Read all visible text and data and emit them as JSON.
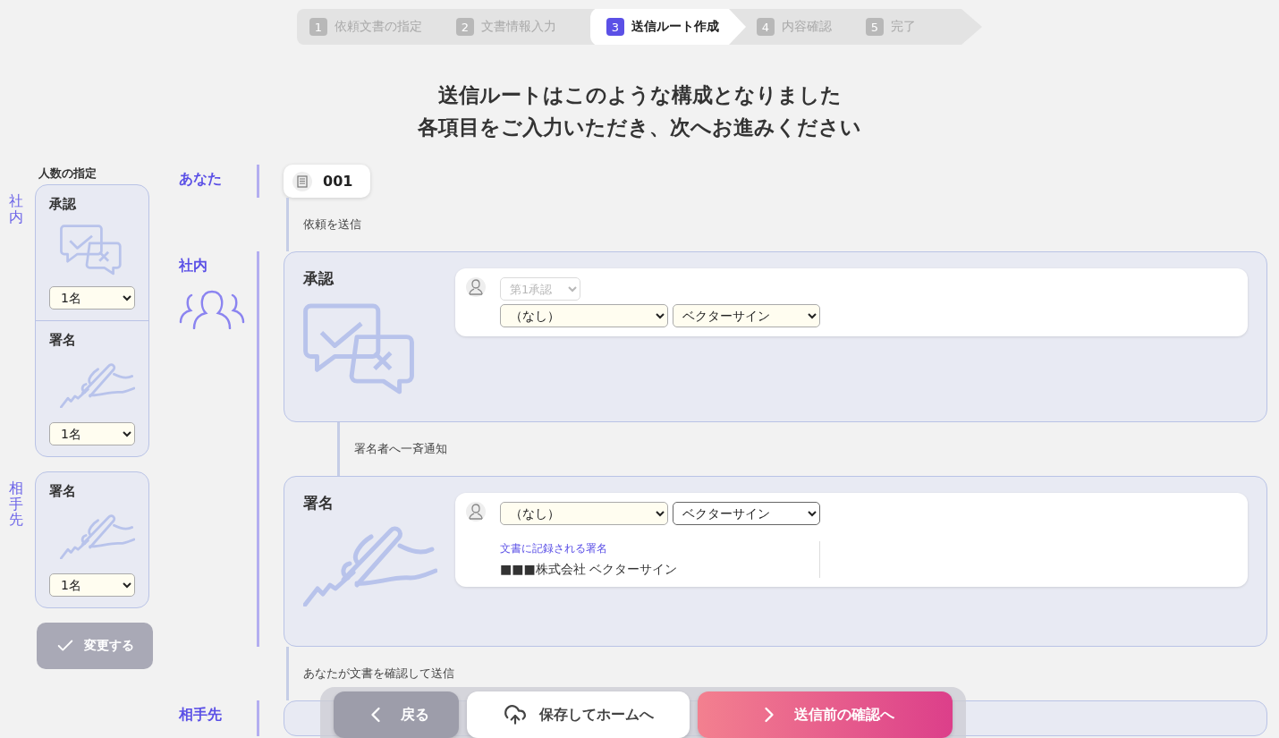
{
  "steps": [
    {
      "number": "1",
      "label": "依頼文書の指定",
      "selected": false
    },
    {
      "number": "2",
      "label": "文書情報入力",
      "selected": false
    },
    {
      "number": "3",
      "label": "送信ルート作成",
      "selected": true
    },
    {
      "number": "4",
      "label": "内容確認",
      "selected": false
    },
    {
      "number": "5",
      "label": "完了",
      "selected": false
    }
  ],
  "heading": [
    "送信ルートはこのような構成となりました",
    "各項目をご入力いただき、次へお進みください"
  ],
  "sidebar": {
    "title": "人数の指定",
    "groups": [
      {
        "label": "社内",
        "items": [
          {
            "kind": "approval",
            "title": "承認",
            "count": "1名"
          },
          {
            "kind": "signature",
            "title": "署名",
            "count": "1名"
          }
        ]
      },
      {
        "label": "相手先",
        "items": [
          {
            "kind": "signature",
            "title": "署名",
            "count": "1名"
          }
        ]
      }
    ],
    "apply_button": {
      "label": "変更する",
      "disabled": true
    }
  },
  "route": {
    "sections": [
      {
        "kind": "you",
        "label": "あなた",
        "document": "001"
      },
      {
        "kind": "connector",
        "text": "依頼を送信"
      },
      {
        "kind": "group",
        "label": "社内",
        "cards": [
          {
            "kind": "approval",
            "title": "承認",
            "order": {
              "value": "第1承認",
              "disabled": true
            },
            "person": {
              "value": "（なし）",
              "highlight": true
            },
            "company": {
              "value": "ベクターサイン",
              "highlight": true
            }
          },
          {
            "kind": "connector",
            "text": "署名者へ一斉通知"
          },
          {
            "kind": "signature",
            "title": "署名",
            "person": {
              "value": "（なし）",
              "highlight": true
            },
            "company": {
              "value": "ベクターサイン",
              "highlight": false
            },
            "record_label": "文書に記録される署名",
            "record_value": "■■■株式会社 ベクターサイン"
          }
        ]
      },
      {
        "kind": "connector",
        "text": "あなたが文書を確認して送信"
      },
      {
        "kind": "group",
        "label": "相手先",
        "cards": [
          {
            "kind": "empty"
          }
        ]
      }
    ]
  },
  "footer": {
    "back": "戻る",
    "save": "保存してホームへ",
    "next": "送信前の確認へ"
  }
}
